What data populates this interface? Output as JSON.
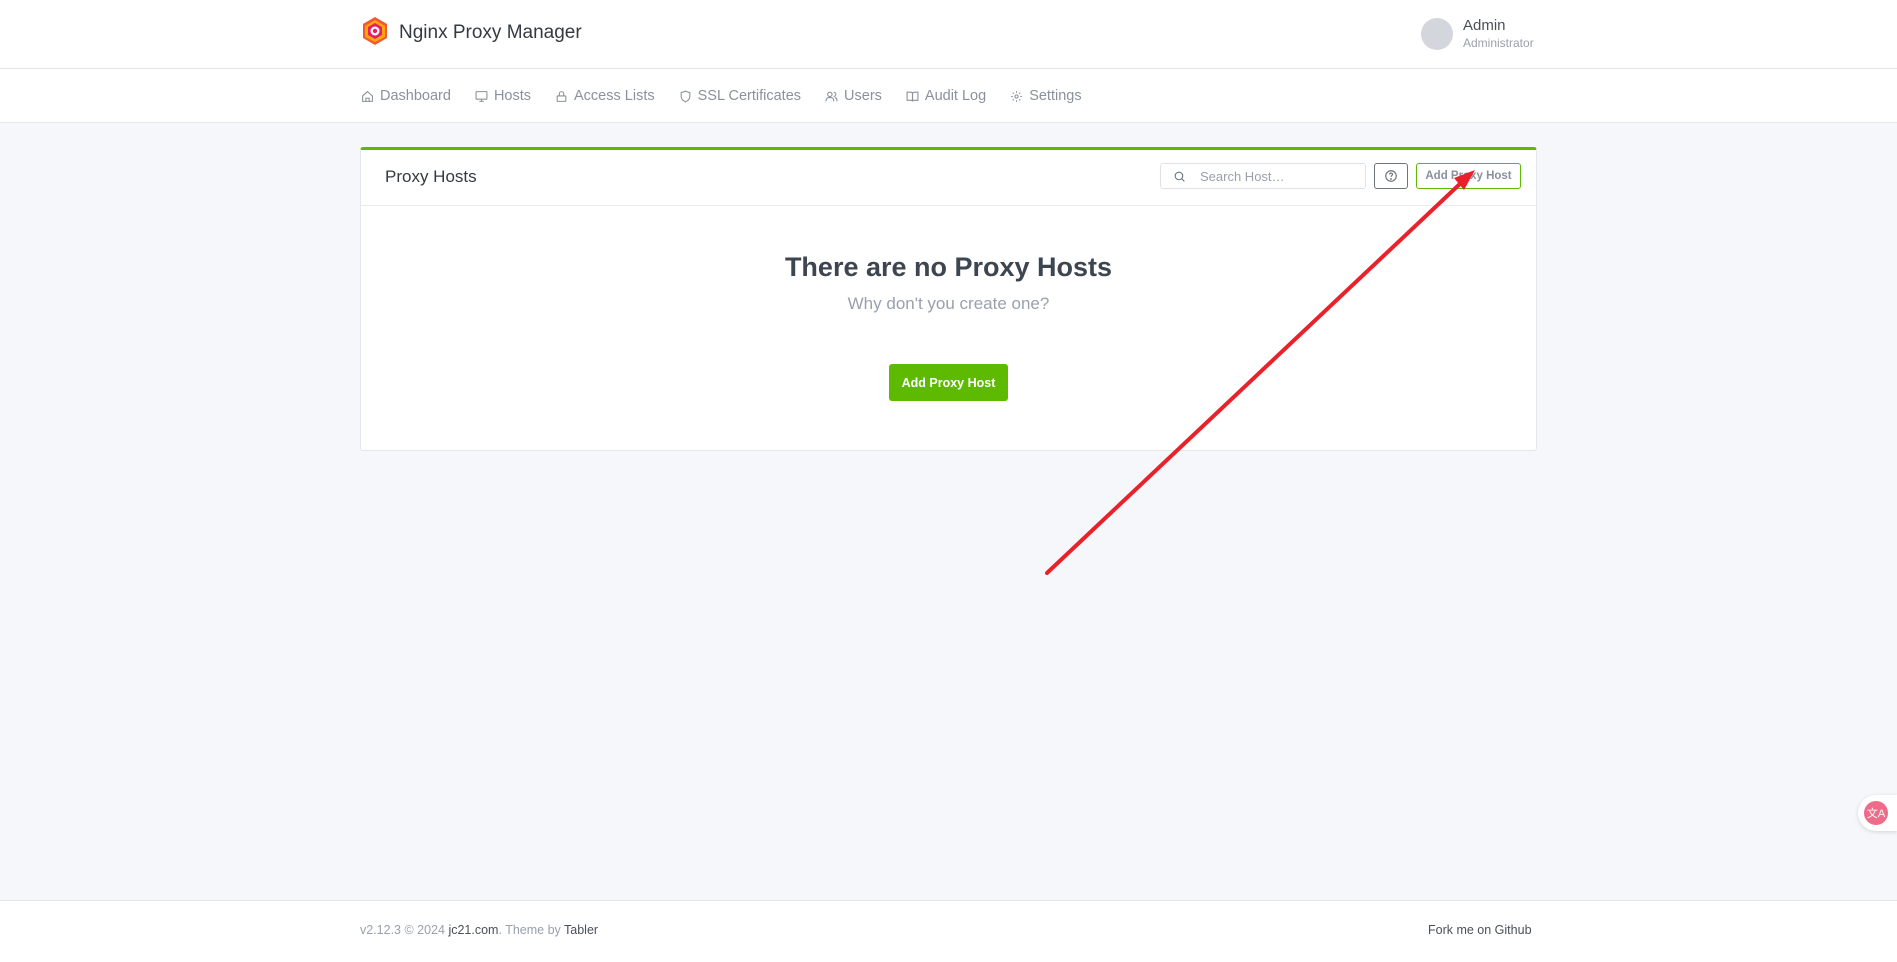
{
  "app": {
    "brand_name": "Nginx Proxy Manager",
    "logo_icon": "nginx-proxy-manager-logo",
    "accent_color": "#5eba00",
    "annotation_color": "#e8212b"
  },
  "user": {
    "name": "Admin",
    "role": "Administrator"
  },
  "nav": {
    "items": [
      {
        "label": "Dashboard",
        "icon": "home-icon"
      },
      {
        "label": "Hosts",
        "icon": "monitor-icon"
      },
      {
        "label": "Access Lists",
        "icon": "lock-icon"
      },
      {
        "label": "SSL Certificates",
        "icon": "shield-icon"
      },
      {
        "label": "Users",
        "icon": "users-icon"
      },
      {
        "label": "Audit Log",
        "icon": "book-icon"
      },
      {
        "label": "Settings",
        "icon": "gear-icon"
      }
    ]
  },
  "card": {
    "title": "Proxy Hosts",
    "search_placeholder": "Search Host…",
    "add_button_label": "Add Proxy Host",
    "empty_title": "There are no Proxy Hosts",
    "empty_subtitle": "Why don't you create one?",
    "empty_add_label": "Add Proxy Host"
  },
  "footer": {
    "version": "v2.12.3 © 2024 ",
    "company": "jc21.com",
    "theme_prefix": ". Theme by ",
    "theme_name": "Tabler",
    "github_link": "Fork me on Github"
  },
  "translate_widget": {
    "glyph": "文A"
  }
}
